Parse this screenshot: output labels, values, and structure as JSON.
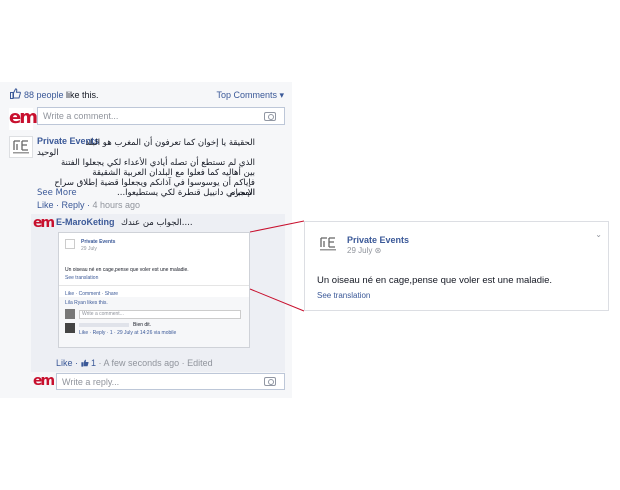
{
  "likebar": {
    "count": "88 people",
    "suffix": " like this.",
    "top_comments": "Top Comments ▾"
  },
  "composer": {
    "placeholder": "Write a comment..."
  },
  "comment": {
    "author": "Private Events",
    "line1": "الحقيقة يا إخوان كما تعرفون أن المغرب هو البلد",
    "line2": "الوحيد",
    "line3": "الذي لم تستطع أن تصله أيادي الأعداء لكي يجعلوا الفتنة",
    "line4": "بين أهاليه كما فعلوا مع البلدان العربية الشقيقة",
    "line5": "فإياكم أن يوسوسوا في آذانكم ويجعلوا قضية إطلاق سراح المجرم",
    "line6": "الإسباني دانييل قنطرة لكي يستطيعوا...",
    "see_more": "See More",
    "actions": "Like · Reply · ",
    "time": "4 hours ago"
  },
  "reply": {
    "author": "E-MaroKeting",
    "text": "الجواب من عندك....",
    "actions_like": "Like · ",
    "likes": "1",
    "time": " · A few seconds ago · Edited"
  },
  "reply_composer": {
    "placeholder": "Write a reply..."
  },
  "thumbnail": {
    "name": "Private Events",
    "date": "29 July",
    "text": "Un oiseau né en cage,pense que voler est une maladie.",
    "trans": "See translation",
    "actions": "Like · Comment · Share",
    "likes": "Lila Ryan likes this.",
    "write": "Write a comment...",
    "c_text": "Bien dit.",
    "c_meta": "Like · Reply · 1 · 29 July at 14:26 via mobile"
  },
  "zoom": {
    "name": "Private Events",
    "date": "29 July",
    "text": "Un oiseau né en cage,pense que voler est une maladie.",
    "translation": "See translation"
  },
  "colors": {
    "link": "#3b5998",
    "brand_red": "#c8102e",
    "panel": "#f6f7f9",
    "connector": "#c8102e"
  }
}
